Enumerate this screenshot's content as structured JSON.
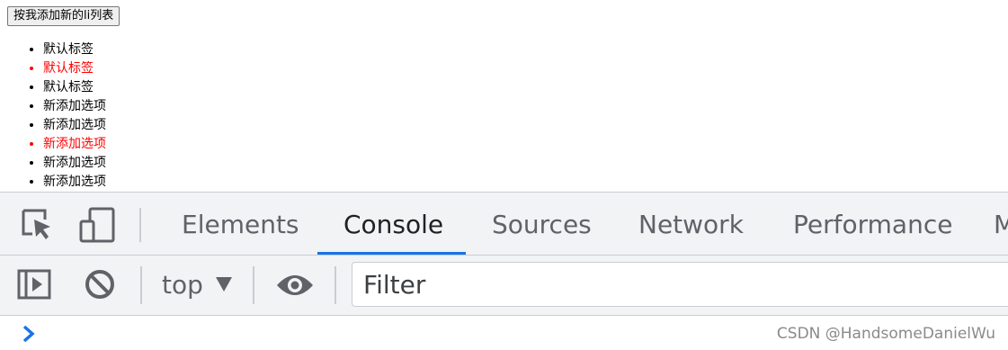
{
  "page": {
    "add_button_label": "按我添加新的li列表",
    "list_items": [
      {
        "text": "默认标签",
        "highlight": false
      },
      {
        "text": "默认标签",
        "highlight": true
      },
      {
        "text": "默认标签",
        "highlight": false
      },
      {
        "text": "新添加选项",
        "highlight": false
      },
      {
        "text": "新添加选项",
        "highlight": false
      },
      {
        "text": "新添加选项",
        "highlight": true
      },
      {
        "text": "新添加选项",
        "highlight": false
      },
      {
        "text": "新添加选项",
        "highlight": false
      }
    ],
    "highlight_color": "#ff0000"
  },
  "devtools": {
    "tabs": [
      {
        "label": "Elements",
        "active": false
      },
      {
        "label": "Console",
        "active": true
      },
      {
        "label": "Sources",
        "active": false
      },
      {
        "label": "Network",
        "active": false
      },
      {
        "label": "Performance",
        "active": false
      },
      {
        "label": "M",
        "active": false
      }
    ],
    "accent_color": "#1a73e8",
    "toolbar": {
      "context": "top",
      "filter_placeholder": "Filter"
    },
    "icons": {
      "inspect": "inspect-element-icon",
      "device": "device-toolbar-icon",
      "sidebar": "console-sidebar-icon",
      "clear": "clear-console-icon",
      "eye": "live-expression-eye-icon",
      "prompt": "console-prompt-chevron-icon"
    }
  },
  "watermark": "CSDN @HandsomeDanielWu"
}
